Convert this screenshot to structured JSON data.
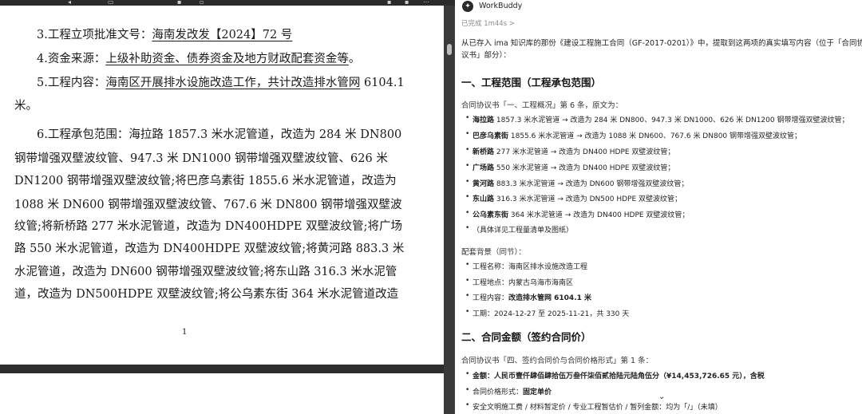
{
  "viewer": {
    "page_number": "1",
    "lines": [
      {
        "pre": "3.工程立项批准文号：",
        "hand": "海南发改发【2024】72 号",
        "post": ""
      },
      {
        "pre": "4.资金来源：",
        "hand": "上级补助资金、债券资金及地方财政配套资金等",
        "post": "。"
      },
      {
        "pre": "5.工程内容：",
        "hand": "海南区开展排水设施改造工作，共计改造排水管网",
        "post": " 6104.1"
      },
      {
        "pre": "米。",
        "hand": "",
        "post": ""
      },
      {
        "pre": "6.工程承包范围：海拉路 1857.3 米水泥管道，改造为 284 米 DN800",
        "hand": "",
        "post": ""
      },
      {
        "pre": "钢带增强双壁波纹管、947.3 米 DN1000 钢带增强双壁波纹管、626 米",
        "hand": "",
        "post": ""
      },
      {
        "pre": "DN1200 钢带增强双壁波纹管;将巴彦乌素街 1855.6 米水泥管道，改造为",
        "hand": "",
        "post": ""
      },
      {
        "pre": "1088 米 DN600 钢带增强双壁波纹管、767.6 米 DN800 钢带增强双壁波",
        "hand": "",
        "post": ""
      },
      {
        "pre": "纹管;将新桥路 277 米水泥管道，改造为 DN400HDPE 双壁波纹管;将广场",
        "hand": "",
        "post": ""
      },
      {
        "pre": "路 550 米水泥管道，改造为 DN400HDPE 双壁波纹管;将黄河路 883.3 米",
        "hand": "",
        "post": ""
      },
      {
        "pre": "水泥管道，改造为 DN600 钢带增强双壁波纹管;将东山路 316.3 米水泥管",
        "hand": "",
        "post": ""
      },
      {
        "pre": "道，改造为 DN500HDPE 双壁波纹管;将公乌素东街 364 米水泥管道改造",
        "hand": "",
        "post": ""
      }
    ]
  },
  "chat": {
    "app_name": "WorkBuddy",
    "status": "已完成  1m44s  >",
    "intro_1": "从已存入 ima 知识库的那份《建设工程施工合同（GF-2017-0201）》中，提取到这两项的真实填写内容（位于「合同协",
    "intro_2": "议书」部分）：",
    "section1_title": "一、工程范围（工程承包范围）",
    "section1_source": "合同协议书「一、工程概况」第 6 条，原文为：",
    "scope_items": [
      {
        "bold": "海拉路",
        "text": " 1857.3 米水泥管道 → 改造为 284 米 DN800、947.3 米 DN1000、626 米 DN1200 钢带增强双壁波纹管；"
      },
      {
        "bold": "巴彦乌素街",
        "text": " 1855.6 米水泥管道 → 改造为 1088 米 DN600、767.6 米 DN800 钢带增强双壁波纹管；"
      },
      {
        "bold": "新桥路",
        "text": " 277 米水泥管道 → 改造为 DN400 HDPE 双壁波纹管；"
      },
      {
        "bold": "广场路",
        "text": " 550 米水泥管道 → 改造为 DN400 HDPE 双壁波纹管；"
      },
      {
        "bold": "黄河路",
        "text": " 883.3 米水泥管道 → 改造为 DN600 钢带增强双壁波纹管；"
      },
      {
        "bold": "东山路",
        "text": " 316.3 米水泥管道 → 改造为 DN500 HDPE 双壁波纹管；"
      },
      {
        "bold": "公乌素东街",
        "text": " 364 米水泥管道 → 改造为 DN400 HDPE 双壁波纹管；"
      },
      {
        "bold": "",
        "text": "（具体详见工程量清单及图纸）"
      }
    ],
    "background_label": "配套背景（同节）：",
    "background_items": [
      {
        "label": "工程名称：",
        "value": "海南区排水设施改造工程",
        "bold_value": false
      },
      {
        "label": "工程地点：",
        "value": "内蒙古乌海市海南区",
        "bold_value": false
      },
      {
        "label": "工程内容：",
        "value": "改造排水管网 6104.1 米",
        "bold_value": true
      },
      {
        "label": "工期：",
        "value": "2024-12-27 至 2025-11-21，共 330 天",
        "bold_value": false
      }
    ],
    "section2_title": "二、合同金额（签约合同价）",
    "section2_source": "合同协议书「四、签约合同价与合同价格形式」第 1 条：",
    "amount_items": [
      {
        "label": "金额：",
        "value": "人民币壹仟肆佰肆拾伍万叁仟柒佰贰拾陆元陆角伍分（¥14,453,726.65 元），含税",
        "bold": true
      },
      {
        "label": "合同价格形式：",
        "value": "固定单价",
        "bold": true
      },
      {
        "label": "",
        "value": "安全文明施工费 / 材料暂定价 / 专业工程暂估价 / 暂列金额：均为「/」（未填）",
        "bold": false
      }
    ]
  }
}
